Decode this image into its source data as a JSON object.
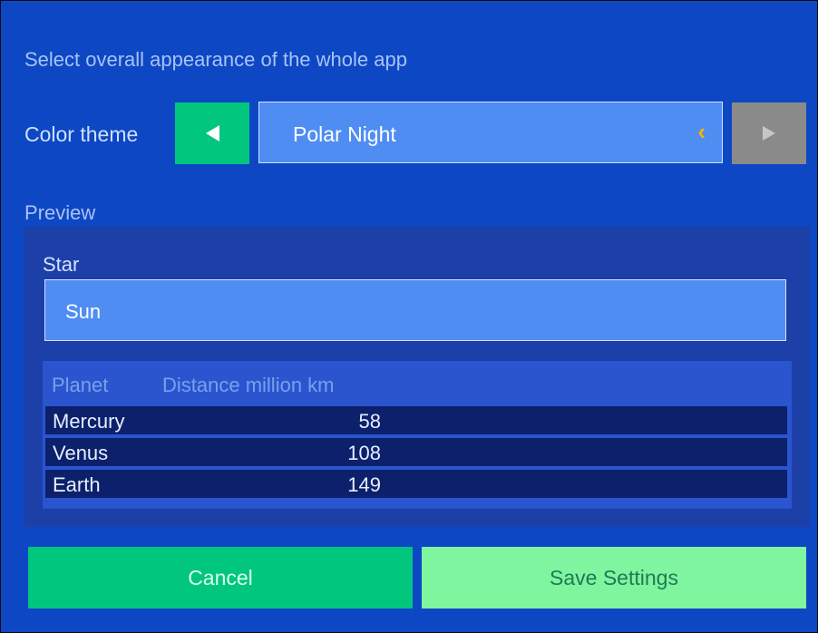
{
  "header": {
    "subtitle": "Select overall appearance of the whole app"
  },
  "theme": {
    "label": "Color theme",
    "selected": "Polar Night",
    "prev_icon": "triangle-left",
    "next_icon": "triangle-right",
    "chevron_icon": "chevron-left",
    "next_disabled": true
  },
  "preview": {
    "label": "Preview",
    "star_label": "Star",
    "star_value": "Sun",
    "table": {
      "columns": [
        "Planet",
        "Distance million km"
      ],
      "rows": [
        {
          "planet": "Mercury",
          "distance": "58"
        },
        {
          "planet": "Venus",
          "distance": "108"
        },
        {
          "planet": "Earth",
          "distance": "149"
        }
      ]
    }
  },
  "actions": {
    "cancel_label": "Cancel",
    "save_label": "Save Settings"
  },
  "colors": {
    "background": "#0d47c4",
    "accent_green": "#00c67e",
    "save_green": "#7ff59f",
    "select_blue": "#4f8df3",
    "chevron_amber": "#f4b400",
    "disabled_gray": "#8a8a8a"
  }
}
